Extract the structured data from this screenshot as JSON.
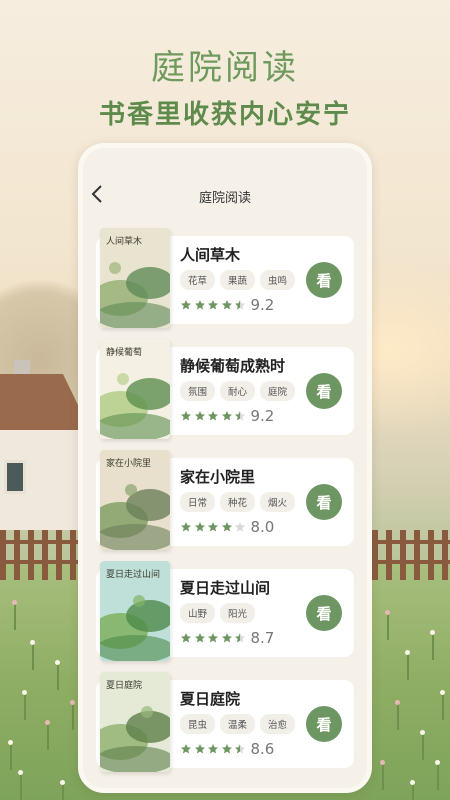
{
  "header": {
    "title": "庭院阅读",
    "subtitle": "书香里收获内心安宁"
  },
  "nav": {
    "back_icon": "chevron-left-icon",
    "title": "庭院阅读"
  },
  "colors": {
    "accent": "#6e9663",
    "title_green": "#6f9a5e",
    "star": "#6e9663"
  },
  "books": [
    {
      "title": "人间草木",
      "tags": [
        "花草",
        "果蔬",
        "虫鸣"
      ],
      "rating_stars": 4.5,
      "score": "9.2",
      "read_label": "看",
      "cover": {
        "top_text": "人间草木",
        "palette": [
          "#e9e4cf",
          "#9cb47a",
          "#5f8b57"
        ]
      }
    },
    {
      "title": "静候葡萄成熟时",
      "tags": [
        "氛围",
        "耐心",
        "庭院"
      ],
      "rating_stars": 4.5,
      "score": "9.2",
      "read_label": "看",
      "cover": {
        "top_text": "静候葡萄",
        "palette": [
          "#f4f1e4",
          "#b7cf8d",
          "#5c8e4e"
        ]
      }
    },
    {
      "title": "家在小院里",
      "tags": [
        "日常",
        "种花",
        "烟火"
      ],
      "rating_stars": 4,
      "score": "8.0",
      "read_label": "看",
      "cover": {
        "top_text": "家在小院里",
        "palette": [
          "#e8e0cc",
          "#8aa36d",
          "#6d7f5a"
        ]
      }
    },
    {
      "title": "夏日走过山间",
      "tags": [
        "山野",
        "阳光"
      ],
      "rating_stars": 4.5,
      "score": "8.7",
      "read_label": "看",
      "cover": {
        "top_text": "夏日走过山间",
        "palette": [
          "#bfe0d9",
          "#82b465",
          "#4d8a4a"
        ]
      }
    },
    {
      "title": "夏日庭院",
      "tags": [
        "昆虫",
        "温柔",
        "治愈"
      ],
      "rating_stars": 4.5,
      "score": "8.6",
      "read_label": "看",
      "cover": {
        "top_text": "夏日庭院",
        "palette": [
          "#e4ead6",
          "#98b77a",
          "#5e7f4a"
        ]
      }
    }
  ]
}
